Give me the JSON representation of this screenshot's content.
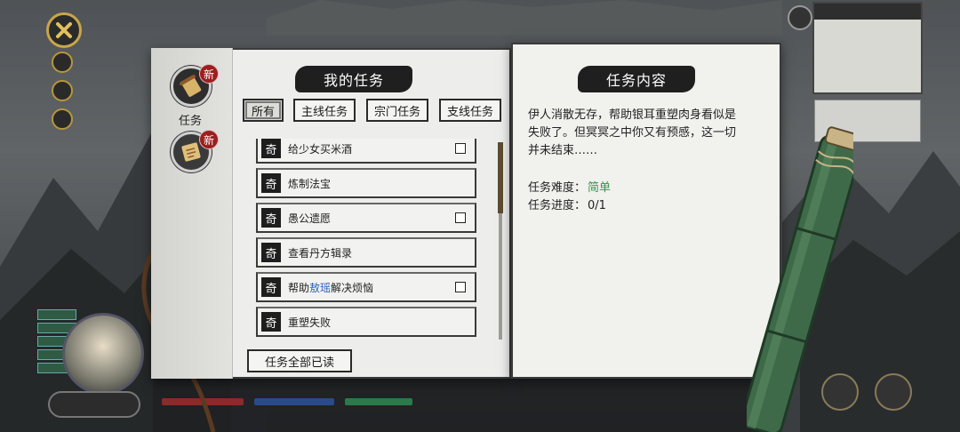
{
  "header": {
    "my_quests_title": "我的任务",
    "quest_content_title": "任务内容"
  },
  "side_tabs": [
    {
      "label": "任务",
      "badge": "新"
    },
    {
      "label": "",
      "badge": "新"
    }
  ],
  "filters": [
    {
      "label": "所有",
      "selected": true
    },
    {
      "label": "主线任务",
      "selected": false
    },
    {
      "label": "宗门任务",
      "selected": false
    },
    {
      "label": "支线任务",
      "selected": false
    }
  ],
  "quest_type_glyph": "奇",
  "quests": [
    {
      "name": "给少女买米酒",
      "has_checkbox": true
    },
    {
      "name": "炼制法宝",
      "has_checkbox": false
    },
    {
      "name": "愚公遗愿",
      "has_checkbox": true
    },
    {
      "name": "查看丹方辑录",
      "has_checkbox": false
    },
    {
      "name_pre": "帮助",
      "name_hl": "敖瑶",
      "name_post": "解决烦恼",
      "has_checkbox": true
    },
    {
      "name": "重塑失败",
      "has_checkbox": false
    }
  ],
  "read_all_label": "任务全部已读",
  "detail": {
    "description": "伊人消散无存，帮助银耳重塑肉身看似是失败了。但冥冥之中你又有预感，这一切并未结束……",
    "difficulty_label": "任务难度：",
    "difficulty_value": "简单",
    "progress_label": "任务进度：",
    "progress_value": "0/1"
  },
  "colors": {
    "easy": "#2f9a44",
    "highlight_name": "#2b62b8",
    "badge": "#9c1f1f"
  }
}
